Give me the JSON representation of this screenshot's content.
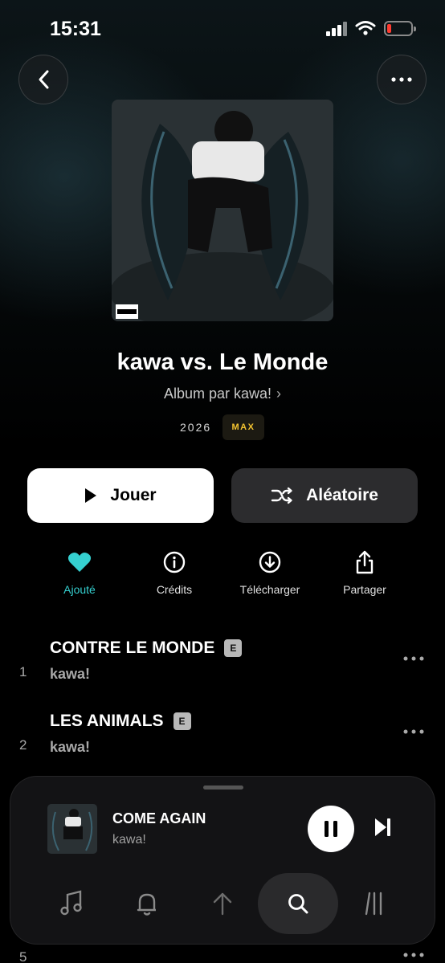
{
  "status_bar": {
    "time": "15:31"
  },
  "album": {
    "title": "kawa vs. Le Monde",
    "subtitle": "Album par kawa!",
    "year": "2026",
    "quality_badge": "MAX",
    "cover_label": "PARENTAL ADVISORY EXPLICIT CONTENT"
  },
  "buttons": {
    "play": "Jouer",
    "shuffle": "Aléatoire"
  },
  "actions": [
    {
      "label": "Ajouté",
      "icon": "heart-icon",
      "active": true
    },
    {
      "label": "Crédits",
      "icon": "info-icon"
    },
    {
      "label": "Télécharger",
      "icon": "download-icon"
    },
    {
      "label": "Partager",
      "icon": "share-icon"
    }
  ],
  "tracks": [
    {
      "number": "1",
      "title": "CONTRE LE MONDE",
      "explicit": "E",
      "artist": "kawa!"
    },
    {
      "number": "2",
      "title": "LES ANIMALS",
      "explicit": "E",
      "artist": "kawa!"
    },
    {
      "number": "5",
      "title": "",
      "explicit": "",
      "artist": ""
    }
  ],
  "now_playing": {
    "title": "COME AGAIN",
    "artist": "kawa!"
  },
  "tabs": [
    {
      "icon": "music-note-icon"
    },
    {
      "icon": "bell-icon"
    },
    {
      "icon": "arrow-up-icon"
    },
    {
      "icon": "search-icon",
      "active": true
    },
    {
      "icon": "library-icon"
    }
  ],
  "colors": {
    "accent": "#35d0d0",
    "max_badge": "#f4c430",
    "battery_low": "#ff3b30"
  }
}
